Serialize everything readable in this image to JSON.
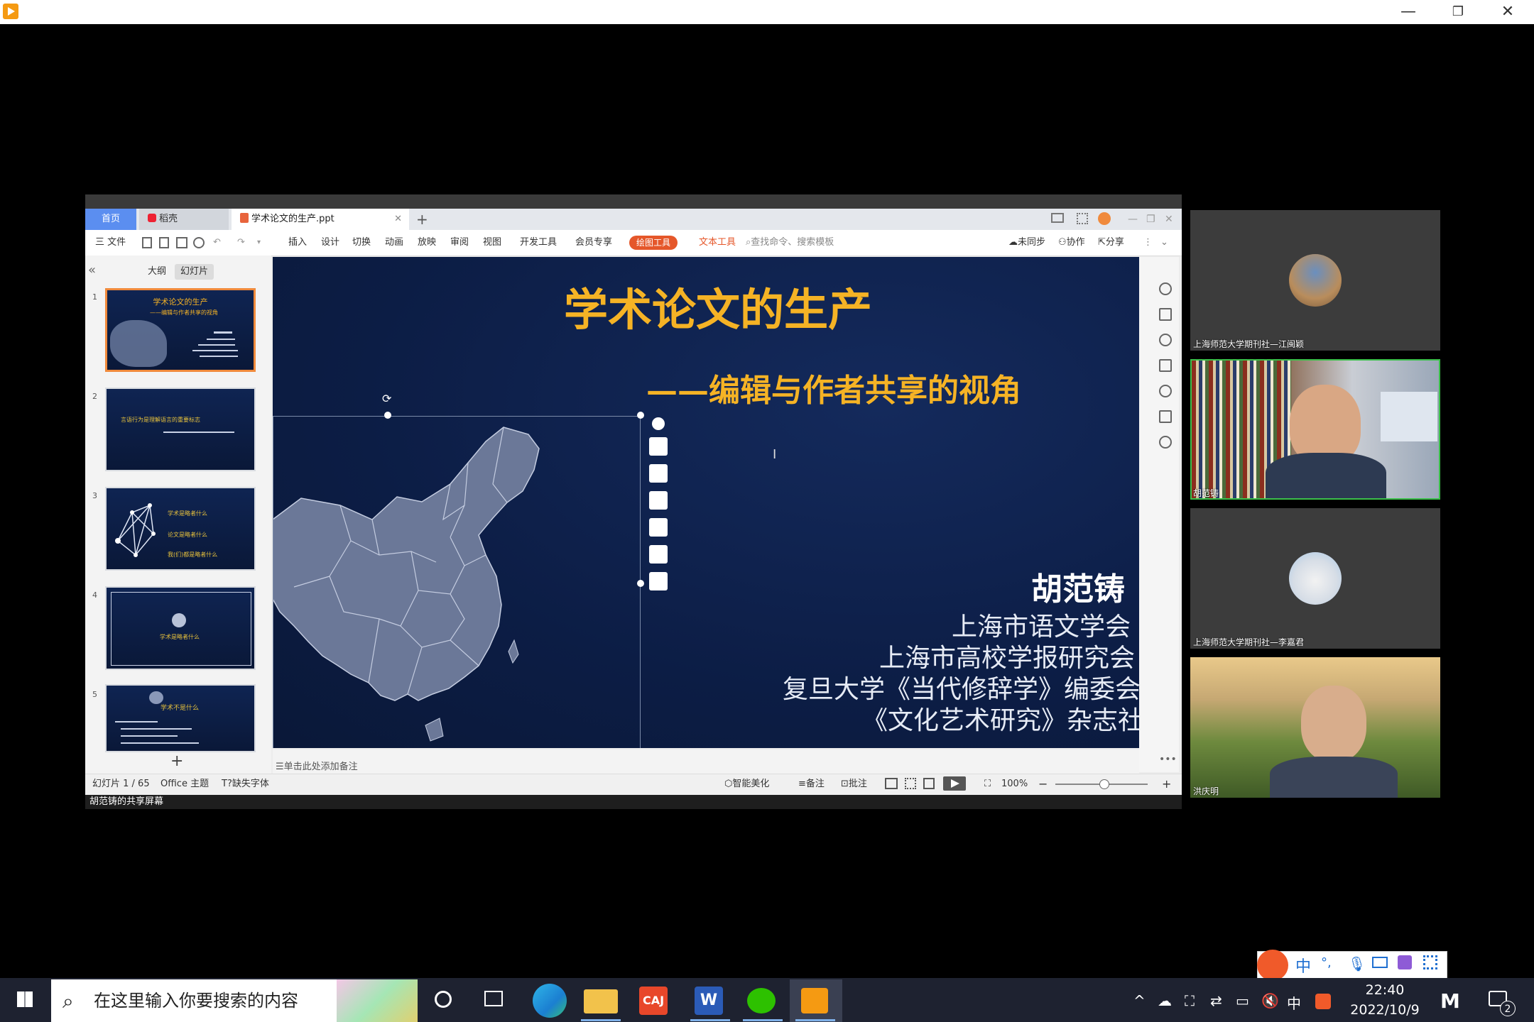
{
  "window": {
    "controls": {
      "minimize": "—",
      "restore": "❐",
      "close": "✕"
    }
  },
  "wps": {
    "tabs": {
      "home": "首页",
      "daoke": "稻壳",
      "file": "学术论文的生产.ppt",
      "new_tab": "+"
    },
    "menu": [
      "三 文件",
      "插入",
      "设计",
      "切换",
      "动画",
      "放映",
      "审阅",
      "视图",
      "开发工具",
      "会员专享"
    ],
    "drawing_tools": "绘图工具",
    "text_tools": "文本工具",
    "search_placeholder": "查找命令、搜索模板",
    "sync": "未同步",
    "collab": "协作",
    "share": "分享",
    "panel_tabs": {
      "outline": "大纲",
      "slides": "幻灯片"
    },
    "add_slide": "+",
    "notes_placeholder": "单击此处添加备注",
    "status": {
      "slide_count": "幻灯片 1 / 65",
      "theme": "Office 主题",
      "missing_font": "缺失字体",
      "beautify": "智能美化",
      "notes": "备注",
      "comments": "批注",
      "zoom": "100%"
    },
    "thumbnails": [
      {
        "num": "1",
        "title": "学术论文的生产",
        "sub": "——编辑与作者共享的视角"
      },
      {
        "num": "2",
        "text": "言语行为是理解语言的重要标志"
      },
      {
        "num": "3",
        "items": [
          "学术是略者什么",
          "论文是略者什么",
          "我(们)都是略者什么"
        ]
      },
      {
        "num": "4",
        "text": "学术是略者什么"
      },
      {
        "num": "5",
        "title": "学术不是什么"
      }
    ]
  },
  "slide": {
    "title": "学术论文的生产",
    "subtitle": "——编辑与作者共享的视角",
    "author": "胡范铸",
    "affiliations": [
      "上海市语文学会",
      "上海市高校学报研究会",
      "复旦大学《当代修辞学》编委会",
      "《文化艺术研究》杂志社"
    ]
  },
  "meeting": {
    "caption": "胡范铸的共享屏幕",
    "participants": [
      {
        "name": "上海师范大学期刊社—江闽颖",
        "type": "avatar"
      },
      {
        "name": "胡范铸",
        "type": "video"
      },
      {
        "name": "上海师范大学期刊社—李嘉君",
        "type": "avatar"
      },
      {
        "name": "洪庆明",
        "type": "video"
      }
    ]
  },
  "ime": {
    "label": "中"
  },
  "taskbar": {
    "search_placeholder": "在这里输入你要搜索的内容",
    "apps": [
      "task-view",
      "edge",
      "file-explorer",
      "caj",
      "word",
      "wechat",
      "tencent-meeting"
    ],
    "caj_label": "CAJ",
    "word_label": "W",
    "tray_lang": "中",
    "time": "22:40",
    "date": "2022/10/9",
    "notification_count": "2"
  },
  "colors": {
    "slide_gold": "#f5b325",
    "slide_bg": "#0c1d45",
    "accent_orange": "#e5572a",
    "wps_blue": "#5b8ef0"
  }
}
